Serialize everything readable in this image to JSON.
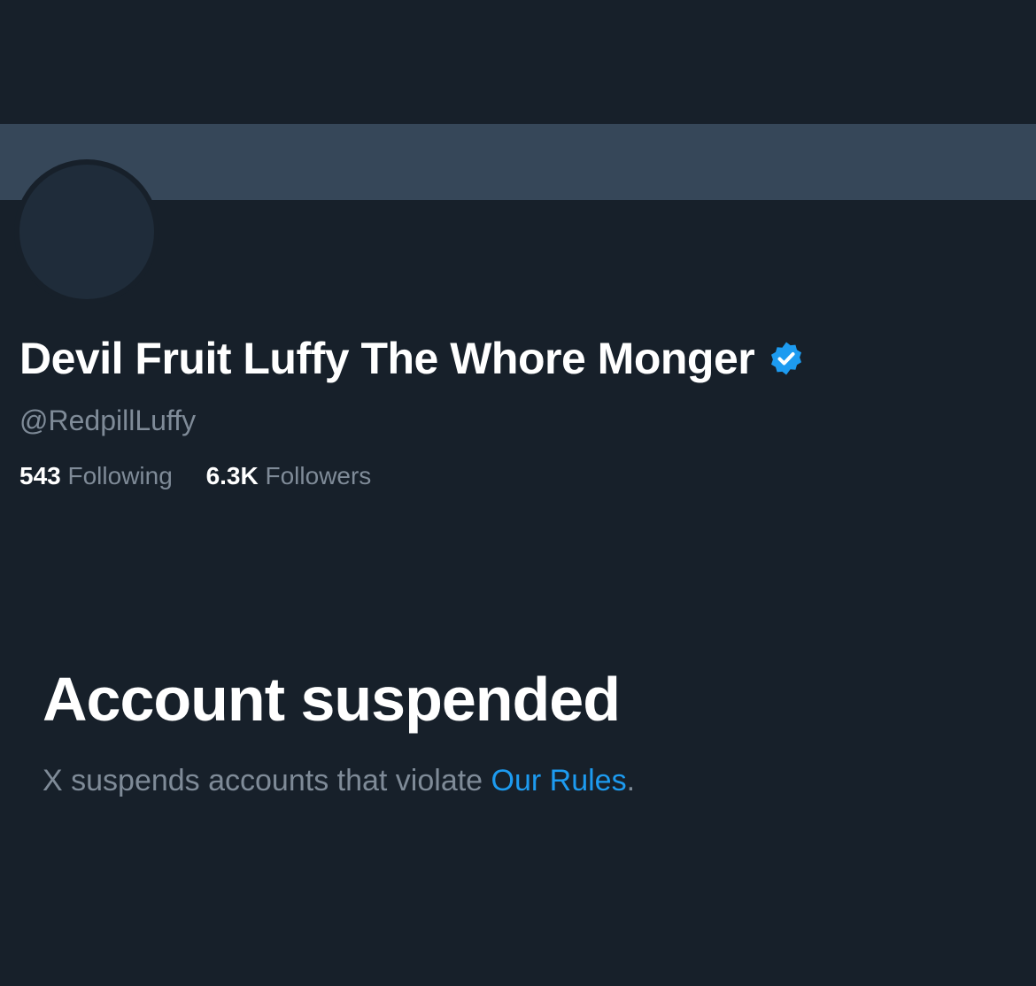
{
  "profile": {
    "display_name": "Devil Fruit Luffy The Whore Monger",
    "verified_icon": "verified-badge-icon",
    "handle": "@RedpillLuffy",
    "stats": {
      "following_count": "543",
      "following_label": "Following",
      "followers_count": "6.3K",
      "followers_label": "Followers"
    }
  },
  "suspension": {
    "title": "Account suspended",
    "message_prefix": "X suspends accounts that violate ",
    "rules_link": "Our Rules",
    "message_suffix": "."
  },
  "colors": {
    "background": "#17202a",
    "banner": "#364759",
    "avatar": "#1f2c3a",
    "muted_text": "#7f8b98",
    "accent": "#1d9bf0"
  }
}
